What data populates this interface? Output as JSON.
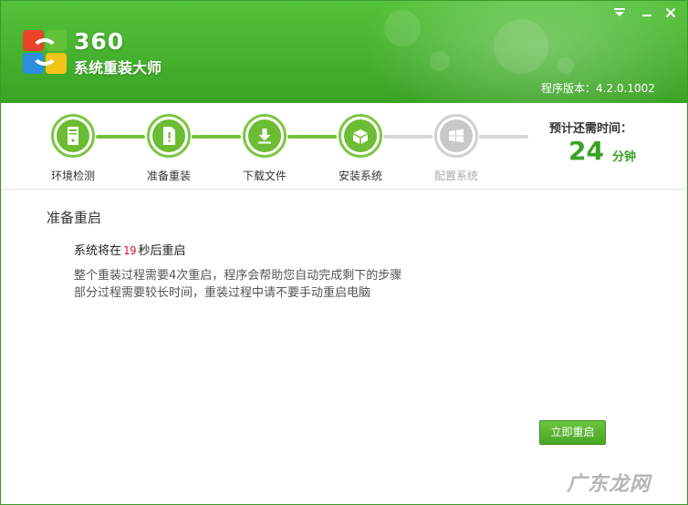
{
  "app": {
    "brand_number": "360",
    "brand_name": "系统重装大师",
    "version_label": "程序版本：",
    "version": "4.2.0.1002"
  },
  "window_controls": {
    "menu_icon": "dropdown-menu-icon",
    "minimize_icon": "minimize-icon",
    "close_icon": "close-icon"
  },
  "steps": [
    {
      "label": "环境检测",
      "icon": "computer-check-icon",
      "state": "done"
    },
    {
      "label": "准备重装",
      "icon": "document-prepare-icon",
      "state": "active"
    },
    {
      "label": "下载文件",
      "icon": "download-icon",
      "state": "done"
    },
    {
      "label": "安装系统",
      "icon": "install-box-icon",
      "state": "done"
    },
    {
      "label": "配置系统",
      "icon": "windows-config-icon",
      "state": "pending"
    }
  ],
  "eta": {
    "label": "预计还需时间：",
    "value": "24",
    "unit": "分钟"
  },
  "main": {
    "heading": "准备重启",
    "countdown_prefix": "系统将在",
    "countdown_seconds": "19",
    "countdown_suffix": "秒后重启",
    "desc_line1": "整个重装过程需要4次重启，程序会帮助您自动完成剩下的步骤",
    "desc_line2": "部分过程需要较长时间，重装过程中请不要手动重启电脑",
    "restart_button": "立即重启"
  },
  "watermark": "广东龙网",
  "colors": {
    "accent": "#46b12e",
    "countdown": "#d0152b",
    "disabled": "#c9c9c9"
  }
}
